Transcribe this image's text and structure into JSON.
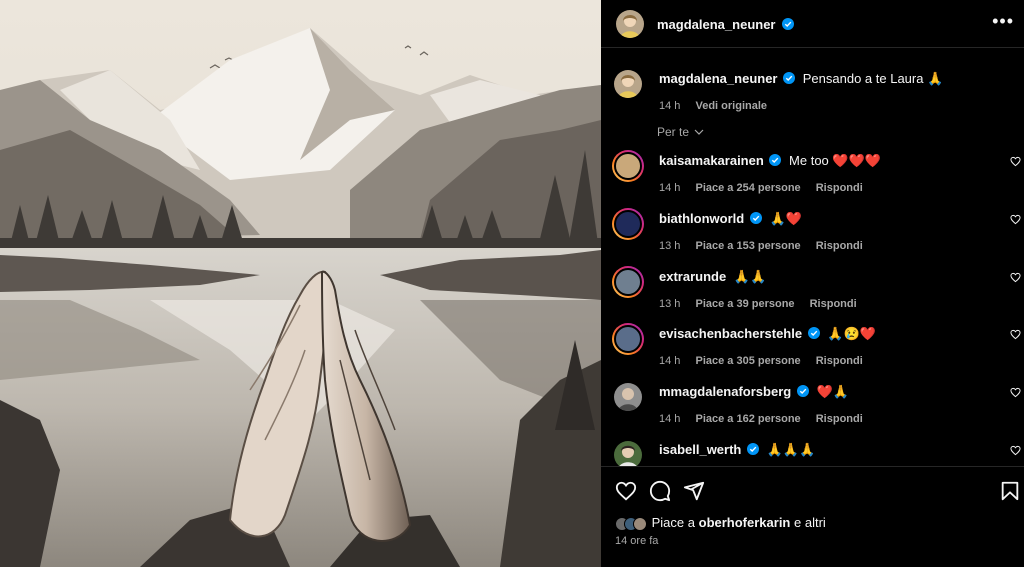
{
  "post": {
    "author": "magdalena_neuner",
    "caption_user": "magdalena_neuner",
    "caption_text": "Pensando a te Laura 🙏",
    "caption_time": "14 h",
    "caption_action": "Vedi originale",
    "filter_label": "Per te"
  },
  "comments": [
    {
      "user": "kaisamakarainen",
      "text": "Me too ❤️❤️❤️",
      "time": "14 h",
      "likes": "Piace a 254 persone",
      "reply": "Rispondi",
      "avatar_color": "#c9a87a"
    },
    {
      "user": "biathlonworld",
      "text": "🙏❤️",
      "time": "13 h",
      "likes": "Piace a 153 persone",
      "reply": "Rispondi",
      "avatar_color": "#1f2a5a"
    },
    {
      "user": "extrarunde",
      "text": "🙏🙏",
      "time": "13 h",
      "likes": "Piace a 39 persone",
      "reply": "Rispondi",
      "avatar_color": "#6f7f90"
    },
    {
      "user": "evisachenbacherstehle",
      "text": "🙏😢❤️",
      "time": "14 h",
      "likes": "Piace a 305 persone",
      "reply": "Rispondi",
      "avatar_color": "#5a6d8a"
    },
    {
      "user": "mmagdalenaforsberg",
      "text": "❤️🙏",
      "time": "14 h",
      "likes": "Piace a 162 persone",
      "reply": "Rispondi",
      "avatar_color": "#8e8e8e"
    },
    {
      "user": "isabell_werth",
      "text": "🙏🙏🙏",
      "time": "",
      "likes": "",
      "reply": "",
      "avatar_color": "#4b6b3c"
    }
  ],
  "footer": {
    "likes_prefix": "Piace a",
    "likes_user": "oberhoferkarin",
    "likes_suffix": "e altri",
    "timestamp": "14 ore fa"
  },
  "colors": {
    "background": "#000000",
    "text": "#f5f5f5",
    "muted": "#a8a8a8",
    "verified": "#0095f6"
  },
  "icons": [
    "more-icon",
    "heart-icon",
    "comment-icon",
    "share-icon",
    "bookmark-icon",
    "verified-icon",
    "chevron-down-icon"
  ]
}
